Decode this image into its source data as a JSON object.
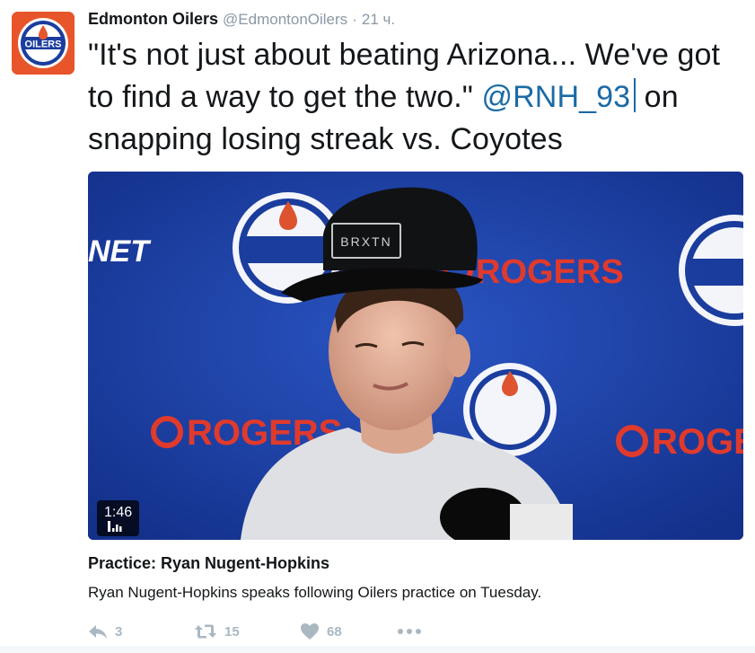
{
  "tweet": {
    "author_name": "Edmonton Oilers",
    "author_handle": "@EdmontonOilers",
    "separator": "·",
    "timestamp": "21 ч.",
    "text_main": "\"It's not just about beating Arizona... We've got to find a way to get the two.\" ",
    "mention": "@RNH_93",
    "text_tail": " on snapping losing streak vs. Coyotes"
  },
  "media": {
    "duration": "1:46",
    "background_text_left": "NET",
    "background_text_rogers": "ROGERS",
    "cap_text": "BRXTN"
  },
  "card": {
    "title": "Practice: Ryan Nugent-Hopkins",
    "description": "Ryan Nugent-Hopkins speaks following Oilers practice on Tuesday."
  },
  "actions": {
    "replies": "3",
    "retweets": "15",
    "likes": "68"
  },
  "colors": {
    "name": "#14171a",
    "meta": "#8899a6",
    "mention": "#1b6aa5",
    "action_icons": "#aab8c2",
    "oilers_blue": "#1b3d9e",
    "oilers_orange": "#e8552a"
  },
  "icons": [
    "oilers-logo",
    "reply-icon",
    "retweet-icon",
    "heart-icon",
    "more-icon",
    "video-stats-icon"
  ]
}
